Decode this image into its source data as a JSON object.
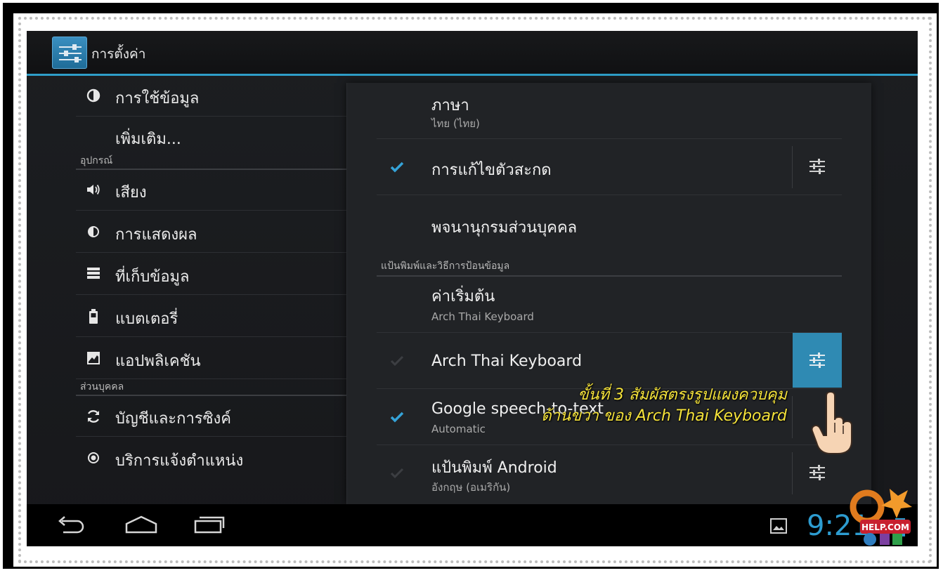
{
  "action_bar": {
    "title": "การตั้งค่า",
    "icon": "settings-sliders-icon"
  },
  "left_list": {
    "items_top": [
      {
        "label": "การใช้ข้อมูล",
        "icon": "data-usage-icon"
      },
      {
        "label": "เพิ่มเติม...",
        "icon": ""
      }
    ],
    "section_device": "อุปกรณ์",
    "items_device": [
      {
        "label": "เสียง",
        "icon": "sound-icon"
      },
      {
        "label": "การแสดงผล",
        "icon": "display-icon"
      },
      {
        "label": "ที่เก็บข้อมูล",
        "icon": "storage-icon"
      },
      {
        "label": "แบตเตอรี่",
        "icon": "battery-icon"
      },
      {
        "label": "แอปพลิเคชัน",
        "icon": "apps-icon"
      }
    ],
    "section_personal": "ส่วนบุคคล",
    "items_personal": [
      {
        "label": "บัญชีและการซิงค์",
        "icon": "sync-icon"
      },
      {
        "label": "บริการแจ้งตำแหน่ง",
        "icon": "location-icon"
      }
    ]
  },
  "right_panel": {
    "language": {
      "title": "ภาษา",
      "value": "ไทย (ไทย)"
    },
    "spell_checker": {
      "title": "การแก้ไขตัวสะกด",
      "checked": true
    },
    "personal_dictionary": {
      "title": "พจนานุกรมส่วนบุคคล"
    },
    "section_keyboard": "แป้นพิมพ์และวิธีการป้อนข้อมูล",
    "default": {
      "title": "ค่าเริ่มต้น",
      "value": "Arch Thai Keyboard"
    },
    "arch_thai": {
      "title": "Arch Thai Keyboard",
      "checked": true,
      "disabled": true
    },
    "google_speech": {
      "title": "Google speech-to-text",
      "value": "Automatic",
      "checked": true
    },
    "android_keyboard": {
      "title": "แป้นพิมพ์ Android",
      "value": "อังกฤษ (อเมริกัน)",
      "checked": true,
      "disabled": true
    }
  },
  "annotation": {
    "line1": "ขั้นที่ 3 สัมผัสตรงรูปแผงควบคุม",
    "line2": "ด้านขวา ของ Arch Thai Keyboard"
  },
  "status_bar": {
    "clock": "9:21"
  },
  "watermark": {
    "text": "HELP.COM"
  },
  "colors": {
    "accent": "#2d9cd0",
    "annotation": "#f5e33b"
  }
}
